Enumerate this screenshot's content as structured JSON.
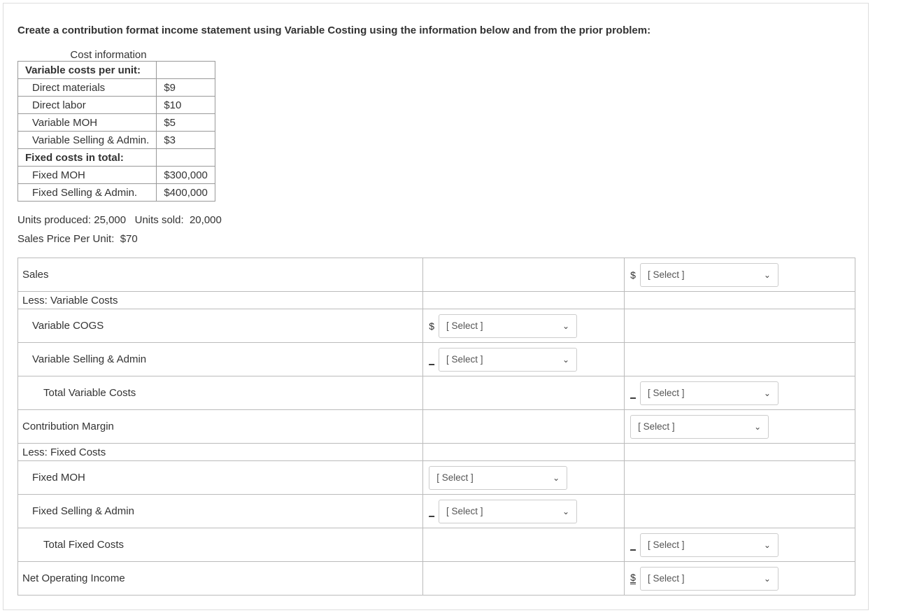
{
  "prompt": "Create a contribution format income statement using Variable Costing using the information below and from the prior problem:",
  "cost_caption": "Cost information",
  "cost_table": {
    "sections": [
      {
        "header": "Variable costs per unit:",
        "rows": [
          {
            "label": "Direct materials",
            "value": "$9"
          },
          {
            "label": "Direct labor",
            "value": "$10"
          },
          {
            "label": "Variable MOH",
            "value": "$5"
          },
          {
            "label": "Variable Selling & Admin.",
            "value": "$3"
          }
        ]
      },
      {
        "header": "Fixed costs in total:",
        "rows": [
          {
            "label": "Fixed MOH",
            "value": "$300,000"
          },
          {
            "label": "Fixed Selling & Admin.",
            "value": "$400,000"
          }
        ]
      }
    ]
  },
  "units_line": "Units produced: 25,000   Units sold:  20,000",
  "price_line": "Sales Price Per Unit:  $70",
  "select_placeholder": "[ Select ]",
  "stmt_rows": [
    {
      "label": "Sales",
      "col2": null,
      "col3": {
        "prefix": "$",
        "select": true
      }
    },
    {
      "label": "Less: Variable Costs",
      "short": true
    },
    {
      "label": "Variable COGS",
      "indent": 1,
      "col2": {
        "prefix": "$",
        "select": true
      }
    },
    {
      "label": "Variable Selling & Admin",
      "indent": 1,
      "col2": {
        "prefix": "_",
        "under": true,
        "select": true
      }
    },
    {
      "label": "Total Variable Costs",
      "indent": 2,
      "col3": {
        "prefix": "_",
        "under": true,
        "select": true
      }
    },
    {
      "label": "Contribution Margin",
      "col3": {
        "select": true
      }
    },
    {
      "label": "Less:  Fixed Costs",
      "short": true
    },
    {
      "label": "Fixed MOH",
      "indent": 1,
      "col2": {
        "select": true
      }
    },
    {
      "label": "Fixed Selling & Admin",
      "indent": 1,
      "col2": {
        "prefix": "_",
        "under": true,
        "select": true
      }
    },
    {
      "label": "Total Fixed Costs",
      "indent": 2,
      "col3": {
        "prefix": "_",
        "under": true,
        "select": true
      }
    },
    {
      "label": "Net Operating Income",
      "col3": {
        "prefix": "$",
        "dbl": true,
        "select": true
      }
    }
  ]
}
